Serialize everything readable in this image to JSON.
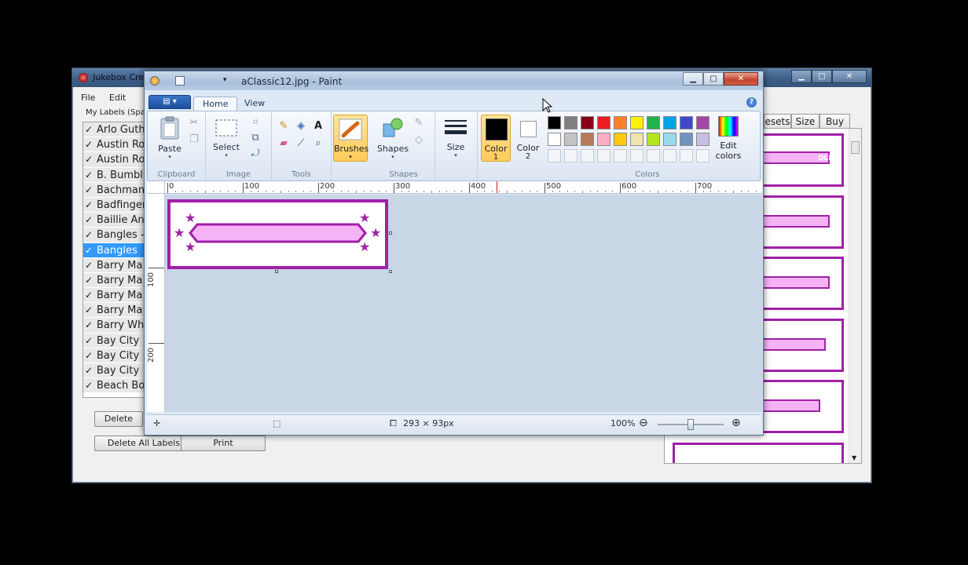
{
  "jukebox": {
    "title": "Jukebox Cre",
    "menu": [
      "File",
      "Edit"
    ],
    "my_labels": "My Labels (Spac",
    "labels": [
      {
        "text": "Arlo Guth",
        "checked": true,
        "selected": false
      },
      {
        "text": "Austin Ro",
        "checked": true,
        "selected": false
      },
      {
        "text": "Austin Ro",
        "checked": true,
        "selected": false
      },
      {
        "text": "B. Bumbl",
        "checked": true,
        "selected": false
      },
      {
        "text": "Bachman",
        "checked": true,
        "selected": false
      },
      {
        "text": "Badfinger",
        "checked": true,
        "selected": false
      },
      {
        "text": "Baillie An",
        "checked": true,
        "selected": false
      },
      {
        "text": "Bangles -",
        "checked": true,
        "selected": false
      },
      {
        "text": "Bangles",
        "checked": true,
        "selected": true
      },
      {
        "text": "Barry Ma",
        "checked": true,
        "selected": false
      },
      {
        "text": "Barry Ma",
        "checked": true,
        "selected": false
      },
      {
        "text": "Barry Ma",
        "checked": true,
        "selected": false
      },
      {
        "text": "Barry Ma",
        "checked": true,
        "selected": false
      },
      {
        "text": "Barry Wh",
        "checked": true,
        "selected": false
      },
      {
        "text": "Bay City",
        "checked": true,
        "selected": false
      },
      {
        "text": "Bay City",
        "checked": true,
        "selected": false
      },
      {
        "text": "Bay City",
        "checked": true,
        "selected": false
      },
      {
        "text": "Beach Bo",
        "checked": true,
        "selected": false
      }
    ],
    "delete_label": "Delete",
    "delete_all_label": "Delete All Labels",
    "print_label": "Print",
    "tabs": [
      "esets",
      "Size",
      "Buy"
    ],
    "preview_badge": "OLDY",
    "check_glyph": "✓"
  },
  "paint": {
    "title": "aClassic12.jpg - Paint",
    "tabs": [
      "Home",
      "View"
    ],
    "groups": {
      "clipboard": {
        "title": "Clipboard",
        "paste": "Paste"
      },
      "image": {
        "title": "Image",
        "select": "Select"
      },
      "tools": {
        "title": "Tools"
      },
      "brushes": {
        "label": "Brushes"
      },
      "shapes": {
        "title": "Shapes",
        "label": "Shapes"
      },
      "size": {
        "label": "Size"
      },
      "color1": {
        "label": "Color",
        "number": "1"
      },
      "color2": {
        "label": "Color",
        "number": "2"
      },
      "colors": {
        "title": "Colors",
        "edit_line1": "Edit",
        "edit_line2": "colors"
      }
    },
    "color1_value": "#000000",
    "color2_value": "#ffffff",
    "palette_row1": [
      "#000000",
      "#7f7f7f",
      "#880015",
      "#ed1c24",
      "#ff7f27",
      "#fff200",
      "#22b14c",
      "#00a2e8",
      "#3f48cc",
      "#a349a4"
    ],
    "palette_row2": [
      "#ffffff",
      "#c3c3c3",
      "#b97a57",
      "#ffaec9",
      "#ffc90e",
      "#efe4b0",
      "#b5e61d",
      "#99d9ea",
      "#7092be",
      "#c8bfe7"
    ],
    "ruler_h_ticks": [
      "0",
      "100",
      "200",
      "300",
      "400",
      "500",
      "600",
      "700"
    ],
    "ruler_v_ticks": [
      "100",
      "200"
    ],
    "status": {
      "image_size": "293 × 93px",
      "zoom": "100%"
    },
    "artwork": {
      "border_color": "#a020a8",
      "band_color": "#f5b3f5"
    }
  }
}
